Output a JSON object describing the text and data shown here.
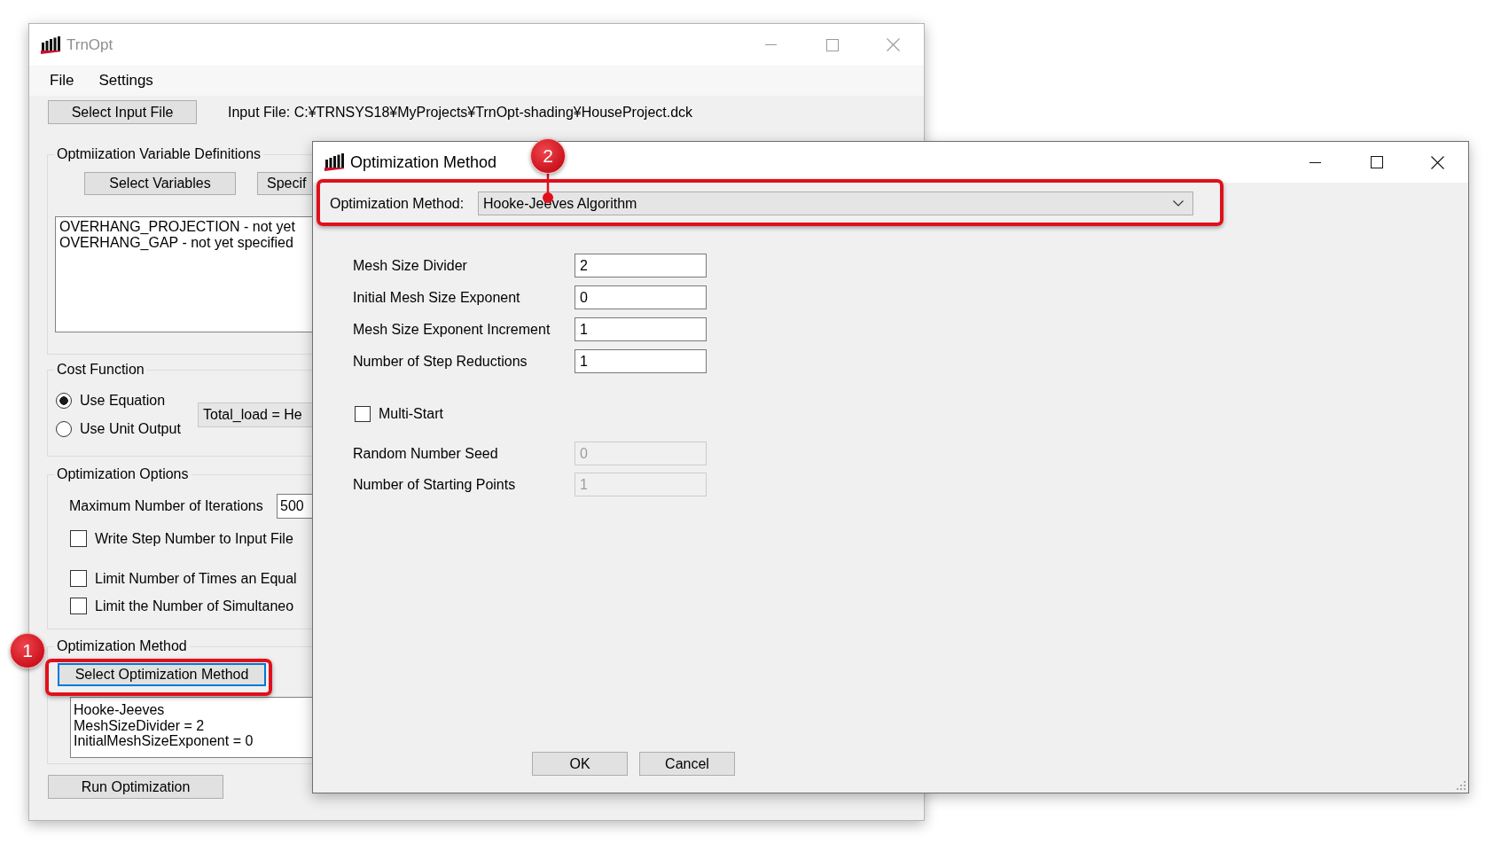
{
  "main_window": {
    "title": "TrnOpt",
    "active": false,
    "menu": [
      {
        "label": "File"
      },
      {
        "label": "Settings"
      }
    ],
    "input_file_button": "Select Input File",
    "input_file_path": "Input File: C:¥TRNSYS18¥MyProjects¥TrnOpt-shading¥HouseProject.dck",
    "variable_definitions": {
      "title": "Optmiization Variable Definitions",
      "buttons": [
        "Select Variables",
        "Specif"
      ],
      "lines": [
        "OVERHANG_PROJECTION - not yet",
        "OVERHANG_GAP - not yet specified"
      ]
    },
    "cost_function": {
      "title": "Cost Function",
      "options": [
        {
          "label": "Use Equation",
          "selected": true
        },
        {
          "label": "Use Unit Output",
          "selected": false
        }
      ],
      "equation": "Total_load = He"
    },
    "optimization_options": {
      "title": "Optimization Options",
      "max_iterations": {
        "label": "Maximum Number of Iterations",
        "value": "500"
      },
      "checkboxes": [
        {
          "label": "Write Step Number to Input File",
          "checked": false
        },
        {
          "label": "Limit Number of Times an Equal",
          "checked": false
        },
        {
          "label": "Limit the Number of Simultaneo",
          "checked": false
        }
      ]
    },
    "optimization_method": {
      "title": "Optimization Method",
      "button": {
        "label": "Select Optimization Method",
        "focused": true
      },
      "summary": [
        "Hooke-Jeeves",
        "MeshSizeDivider = 2",
        "InitialMeshSizeExponent = 0"
      ]
    },
    "run_button": "Run Optimization"
  },
  "dialog": {
    "title": "Optimization Method",
    "active": true,
    "method": {
      "label": "Optimization Method:",
      "value": "Hooke-Jeeves Algorithm"
    },
    "parameters": [
      {
        "label": "Mesh Size Divider",
        "value": "2",
        "disabled": false
      },
      {
        "label": "Initial Mesh Size Exponent",
        "value": "0",
        "disabled": false
      },
      {
        "label": "Mesh Size Exponent Increment",
        "value": "1",
        "disabled": false
      },
      {
        "label": "Number of Step Reductions",
        "value": "1",
        "disabled": false
      }
    ],
    "multi_start": {
      "label": "Multi-Start",
      "checked": false
    },
    "multi_start_parameters": [
      {
        "label": "Random Number Seed",
        "value": "0",
        "disabled": true
      },
      {
        "label": "Number of Starting Points",
        "value": "1",
        "disabled": true
      }
    ],
    "buttons": [
      "OK",
      "Cancel"
    ]
  },
  "annotations": [
    {
      "number": "1"
    },
    {
      "number": "2"
    }
  ]
}
